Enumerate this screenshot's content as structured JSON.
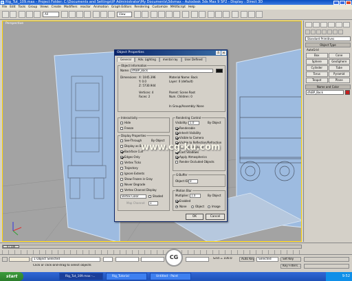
{
  "window": {
    "title": "Rig_Tut_109.max - Project Folder: C:\\Documents and Settings\\IP Administrator\\My Documents\\3dsmax - Autodesk 3ds Max 9 SP2 - Display : Direct 3D"
  },
  "menu": [
    "File",
    "Edit",
    "Tools",
    "Group",
    "Views",
    "Create",
    "Modifiers",
    "reactor",
    "Animation",
    "Graph Editors",
    "Rendering",
    "Customize",
    "MAXScript",
    "Help"
  ],
  "toolbar": {
    "selection_filter": "All",
    "view_dropdown": "View"
  },
  "viewport": {
    "label": "Perspective"
  },
  "command_panel": {
    "category": "Standard Primitives",
    "rollout_object_type": "Object Type",
    "autogrid": "AutoGrid",
    "primitives": [
      "Box",
      "Cone",
      "Sphere",
      "GeoSphere",
      "Cylinder",
      "Tube",
      "Torus",
      "Pyramid",
      "Teapot",
      "Plane"
    ],
    "rollout_name_color": "Name and Color",
    "object_name": "dfsBP_Back"
  },
  "dialog": {
    "title": "Object Properties",
    "tabs": [
      "General",
      "Adv. Lighting",
      "mental ray",
      "User Defined"
    ],
    "info_group": "Object Information",
    "name_label": "Name:",
    "name_value": "dfsBP_Back",
    "dimensions_label": "Dimensions:",
    "dim_x": "X: 1045.396",
    "dim_y": "Y: 0.0",
    "dim_z": "Z: 5730.944",
    "material_name": "Material Name: Back",
    "layer": "Layer:  0 (default)",
    "vertices": "Vertices: 4",
    "faces": "Faces: 2",
    "parent": "Parent:  Scene Root",
    "num_children": "Num. Children: 0",
    "in_group": "In Group/Assembly: None",
    "interactivity_group": "Interactivity",
    "hide": "Hide",
    "freeze": "Freeze",
    "display_group": "Display Properties",
    "see_through": "See-Through",
    "display_as_box": "Display as Box",
    "backface_cull": "Backface Cull",
    "edges_only": "Edges Only",
    "vertex_ticks": "Vertex Ticks",
    "trajectory": "Trajectory",
    "ignore_extents": "Ignore Extents",
    "show_frozen_gray": "Show Frozen in Gray",
    "never_degrade": "Never Degrade",
    "vertex_channel_display": "Vertex Channel Display",
    "vertex_color_select": "Vertex Color",
    "shaded": "Shaded",
    "map_channel": "Map Channel:",
    "map_channel_value": "1",
    "by_object": "By Object",
    "rendering_group": "Rendering Control",
    "visibility": "Visibility:",
    "visibility_value": "1.0",
    "renderable": "Renderable",
    "inherit_visibility": "Inherit Visibility",
    "visible_to_camera": "Visible to Camera",
    "visible_reflection": "Visible to Reflection/Refraction",
    "receive_shadows": "Receive Shadows",
    "cast_shadows": "Cast Shadows",
    "apply_atmospherics": "Apply Atmospherics",
    "render_occluded": "Render Occluded Objects",
    "gbuffer_group": "G-Buffer",
    "object_id": "Object ID:",
    "object_id_value": "0",
    "motion_blur_group": "Motion Blur",
    "multiplier": "Multiplier:",
    "multiplier_value": "1.0",
    "enabled": "Enabled",
    "none": "None",
    "object": "Object",
    "image": "Image",
    "ok": "OK",
    "cancel": "Cancel"
  },
  "watermark": {
    "text": "www.cg-ku.com",
    "logo_text": "CG"
  },
  "timeline": {
    "slider_label": "0 / 100"
  },
  "status": {
    "selection": "1 Object Selected",
    "prompt": "Click or click-and-drag to select objects",
    "grid": "Grid = 100.0",
    "auto_key": "Auto Key",
    "selected": "Selected",
    "set_key": "Set Key",
    "key_filters": "Key Filters..."
  },
  "taskbar": {
    "start": "start",
    "tasks": [
      "Rig_Tut_109.max -...",
      "Rig_Tutorial",
      "Untitled - Paint"
    ],
    "clock": "9:52"
  }
}
